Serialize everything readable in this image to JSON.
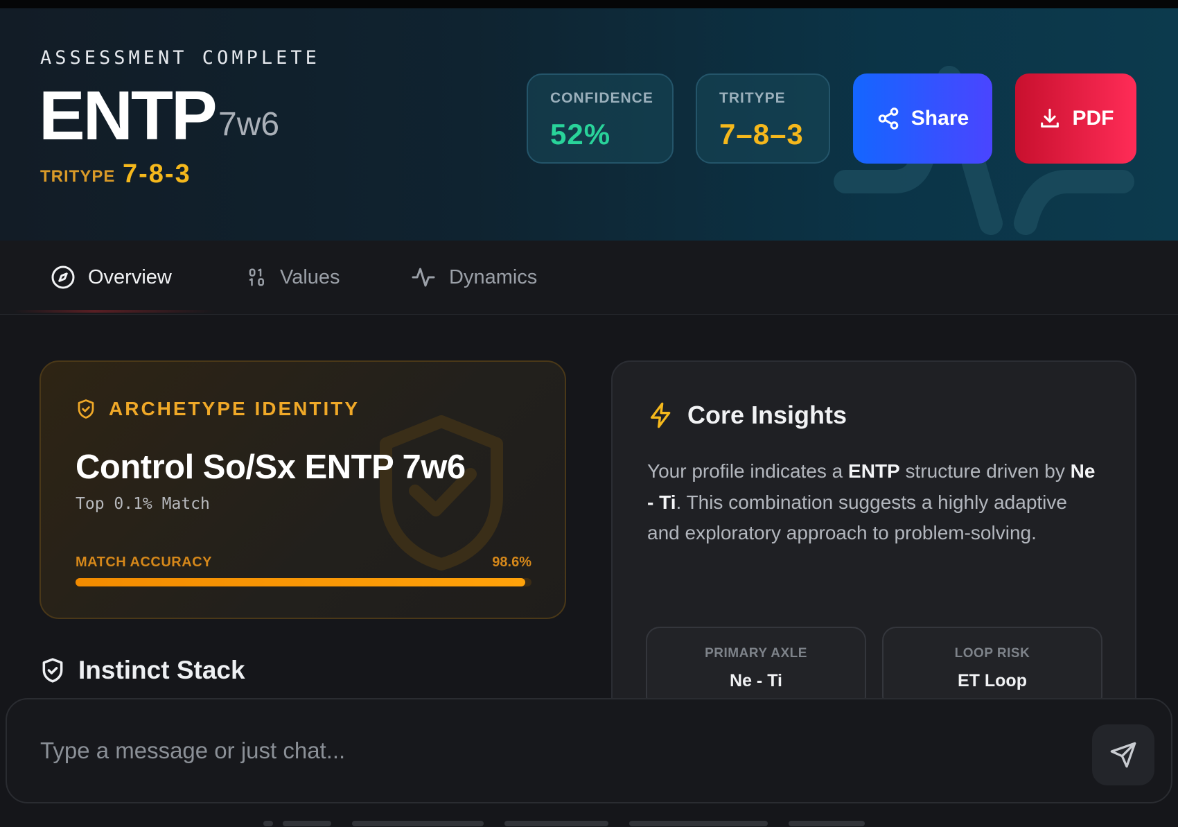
{
  "header": {
    "eyebrow": "ASSESSMENT COMPLETE",
    "type": "ENTP",
    "wing": "7w6",
    "tritype_label": "TRITYPE",
    "tritype_value": "7-8-3",
    "stats": [
      {
        "label": "CONFIDENCE",
        "value": "52%",
        "color": "#29d39a"
      },
      {
        "label": "TRITYPE",
        "value": "7–8–3",
        "color": "#f5b81c"
      }
    ],
    "share_label": "Share",
    "pdf_label": "PDF",
    "share_icon": "share-icon",
    "pdf_icon": "download-icon"
  },
  "tabs": [
    {
      "label": "Overview",
      "icon": "compass-icon",
      "active": true
    },
    {
      "label": "Values",
      "icon": "binary-icon",
      "active": false
    },
    {
      "label": "Dynamics",
      "icon": "activity-icon",
      "active": false
    }
  ],
  "archetype": {
    "heading": "ARCHETYPE IDENTITY",
    "title": "Control So/Sx ENTP 7w6",
    "subtitle": "Top 0.1% Match",
    "accuracy_label": "MATCH ACCURACY",
    "accuracy_value": "98.6%",
    "accuracy_fraction": 0.986,
    "accent": "#f0a928"
  },
  "instinct_stack": {
    "title": "Instinct Stack"
  },
  "core_insights": {
    "title": "Core Insights",
    "body_prefix": "Your profile indicates a ",
    "body_type": "ENTP",
    "body_mid": " structure driven by ",
    "body_axis": "Ne - Ti",
    "body_suffix": ". This combination suggests a highly adaptive and exploratory approach to problem-solving.",
    "cards": [
      {
        "label": "PRIMARY AXLE",
        "value": "Ne - Ti"
      },
      {
        "label": "LOOP RISK",
        "value": "ET Loop"
      }
    ]
  },
  "chat": {
    "placeholder": "Type a message or just chat...",
    "send_icon": "send-icon"
  }
}
